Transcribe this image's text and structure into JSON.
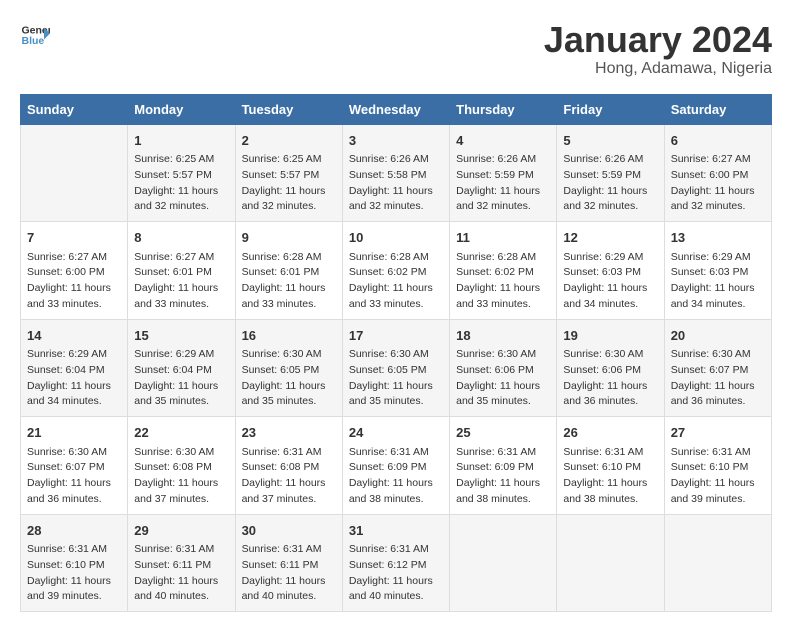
{
  "header": {
    "logo_line1": "General",
    "logo_line2": "Blue",
    "month": "January 2024",
    "location": "Hong, Adamawa, Nigeria"
  },
  "weekdays": [
    "Sunday",
    "Monday",
    "Tuesday",
    "Wednesday",
    "Thursday",
    "Friday",
    "Saturday"
  ],
  "weeks": [
    [
      {
        "day": "",
        "sunrise": "",
        "sunset": "",
        "daylight": ""
      },
      {
        "day": "1",
        "sunrise": "Sunrise: 6:25 AM",
        "sunset": "Sunset: 5:57 PM",
        "daylight": "Daylight: 11 hours and 32 minutes."
      },
      {
        "day": "2",
        "sunrise": "Sunrise: 6:25 AM",
        "sunset": "Sunset: 5:57 PM",
        "daylight": "Daylight: 11 hours and 32 minutes."
      },
      {
        "day": "3",
        "sunrise": "Sunrise: 6:26 AM",
        "sunset": "Sunset: 5:58 PM",
        "daylight": "Daylight: 11 hours and 32 minutes."
      },
      {
        "day": "4",
        "sunrise": "Sunrise: 6:26 AM",
        "sunset": "Sunset: 5:59 PM",
        "daylight": "Daylight: 11 hours and 32 minutes."
      },
      {
        "day": "5",
        "sunrise": "Sunrise: 6:26 AM",
        "sunset": "Sunset: 5:59 PM",
        "daylight": "Daylight: 11 hours and 32 minutes."
      },
      {
        "day": "6",
        "sunrise": "Sunrise: 6:27 AM",
        "sunset": "Sunset: 6:00 PM",
        "daylight": "Daylight: 11 hours and 32 minutes."
      }
    ],
    [
      {
        "day": "7",
        "sunrise": "Sunrise: 6:27 AM",
        "sunset": "Sunset: 6:00 PM",
        "daylight": "Daylight: 11 hours and 33 minutes."
      },
      {
        "day": "8",
        "sunrise": "Sunrise: 6:27 AM",
        "sunset": "Sunset: 6:01 PM",
        "daylight": "Daylight: 11 hours and 33 minutes."
      },
      {
        "day": "9",
        "sunrise": "Sunrise: 6:28 AM",
        "sunset": "Sunset: 6:01 PM",
        "daylight": "Daylight: 11 hours and 33 minutes."
      },
      {
        "day": "10",
        "sunrise": "Sunrise: 6:28 AM",
        "sunset": "Sunset: 6:02 PM",
        "daylight": "Daylight: 11 hours and 33 minutes."
      },
      {
        "day": "11",
        "sunrise": "Sunrise: 6:28 AM",
        "sunset": "Sunset: 6:02 PM",
        "daylight": "Daylight: 11 hours and 33 minutes."
      },
      {
        "day": "12",
        "sunrise": "Sunrise: 6:29 AM",
        "sunset": "Sunset: 6:03 PM",
        "daylight": "Daylight: 11 hours and 34 minutes."
      },
      {
        "day": "13",
        "sunrise": "Sunrise: 6:29 AM",
        "sunset": "Sunset: 6:03 PM",
        "daylight": "Daylight: 11 hours and 34 minutes."
      }
    ],
    [
      {
        "day": "14",
        "sunrise": "Sunrise: 6:29 AM",
        "sunset": "Sunset: 6:04 PM",
        "daylight": "Daylight: 11 hours and 34 minutes."
      },
      {
        "day": "15",
        "sunrise": "Sunrise: 6:29 AM",
        "sunset": "Sunset: 6:04 PM",
        "daylight": "Daylight: 11 hours and 35 minutes."
      },
      {
        "day": "16",
        "sunrise": "Sunrise: 6:30 AM",
        "sunset": "Sunset: 6:05 PM",
        "daylight": "Daylight: 11 hours and 35 minutes."
      },
      {
        "day": "17",
        "sunrise": "Sunrise: 6:30 AM",
        "sunset": "Sunset: 6:05 PM",
        "daylight": "Daylight: 11 hours and 35 minutes."
      },
      {
        "day": "18",
        "sunrise": "Sunrise: 6:30 AM",
        "sunset": "Sunset: 6:06 PM",
        "daylight": "Daylight: 11 hours and 35 minutes."
      },
      {
        "day": "19",
        "sunrise": "Sunrise: 6:30 AM",
        "sunset": "Sunset: 6:06 PM",
        "daylight": "Daylight: 11 hours and 36 minutes."
      },
      {
        "day": "20",
        "sunrise": "Sunrise: 6:30 AM",
        "sunset": "Sunset: 6:07 PM",
        "daylight": "Daylight: 11 hours and 36 minutes."
      }
    ],
    [
      {
        "day": "21",
        "sunrise": "Sunrise: 6:30 AM",
        "sunset": "Sunset: 6:07 PM",
        "daylight": "Daylight: 11 hours and 36 minutes."
      },
      {
        "day": "22",
        "sunrise": "Sunrise: 6:30 AM",
        "sunset": "Sunset: 6:08 PM",
        "daylight": "Daylight: 11 hours and 37 minutes."
      },
      {
        "day": "23",
        "sunrise": "Sunrise: 6:31 AM",
        "sunset": "Sunset: 6:08 PM",
        "daylight": "Daylight: 11 hours and 37 minutes."
      },
      {
        "day": "24",
        "sunrise": "Sunrise: 6:31 AM",
        "sunset": "Sunset: 6:09 PM",
        "daylight": "Daylight: 11 hours and 38 minutes."
      },
      {
        "day": "25",
        "sunrise": "Sunrise: 6:31 AM",
        "sunset": "Sunset: 6:09 PM",
        "daylight": "Daylight: 11 hours and 38 minutes."
      },
      {
        "day": "26",
        "sunrise": "Sunrise: 6:31 AM",
        "sunset": "Sunset: 6:10 PM",
        "daylight": "Daylight: 11 hours and 38 minutes."
      },
      {
        "day": "27",
        "sunrise": "Sunrise: 6:31 AM",
        "sunset": "Sunset: 6:10 PM",
        "daylight": "Daylight: 11 hours and 39 minutes."
      }
    ],
    [
      {
        "day": "28",
        "sunrise": "Sunrise: 6:31 AM",
        "sunset": "Sunset: 6:10 PM",
        "daylight": "Daylight: 11 hours and 39 minutes."
      },
      {
        "day": "29",
        "sunrise": "Sunrise: 6:31 AM",
        "sunset": "Sunset: 6:11 PM",
        "daylight": "Daylight: 11 hours and 40 minutes."
      },
      {
        "day": "30",
        "sunrise": "Sunrise: 6:31 AM",
        "sunset": "Sunset: 6:11 PM",
        "daylight": "Daylight: 11 hours and 40 minutes."
      },
      {
        "day": "31",
        "sunrise": "Sunrise: 6:31 AM",
        "sunset": "Sunset: 6:12 PM",
        "daylight": "Daylight: 11 hours and 40 minutes."
      },
      {
        "day": "",
        "sunrise": "",
        "sunset": "",
        "daylight": ""
      },
      {
        "day": "",
        "sunrise": "",
        "sunset": "",
        "daylight": ""
      },
      {
        "day": "",
        "sunrise": "",
        "sunset": "",
        "daylight": ""
      }
    ]
  ]
}
